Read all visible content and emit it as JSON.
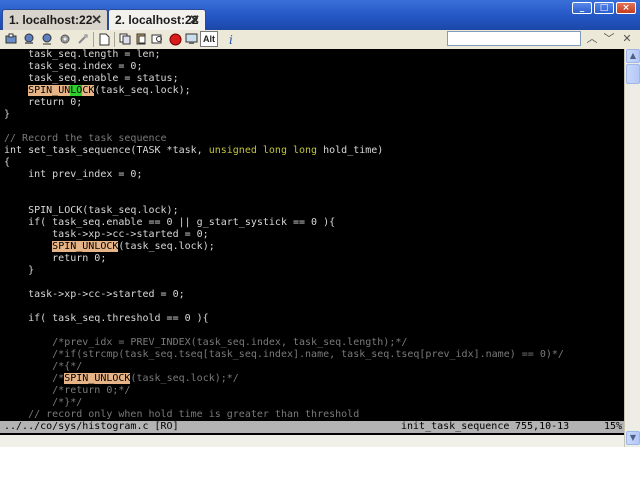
{
  "tabs": [
    {
      "label": "1. localhost:22"
    },
    {
      "label": "2. localhost:22"
    }
  ],
  "window_buttons": {
    "minimize": "_",
    "maximize": "□",
    "close": "×"
  },
  "toolbar": {
    "alt_label": "Alt",
    "search_value": "",
    "icons": [
      "connect-icon",
      "disconnect-icon",
      "new-session-icon",
      "settings-icon",
      "page-icon",
      "copy-icon",
      "paste-icon",
      "find-icon",
      "record-icon",
      "screen-icon",
      "alt-key-button",
      "info-icon"
    ]
  },
  "code_lines": [
    [
      {
        "t": "    task_seq.length = len;"
      }
    ],
    [
      {
        "t": "    task_seq.index = 0;"
      }
    ],
    [
      {
        "t": "    task_seq.enable = status;"
      }
    ],
    [
      {
        "t": "    "
      },
      {
        "t": "SPIN_UN",
        "k": "hl"
      },
      {
        "t": "L",
        "k": "cur"
      },
      {
        "t": "O",
        "k": "cur"
      },
      {
        "t": "CK",
        "k": "hl"
      },
      {
        "t": "(task_seq.lock);"
      }
    ],
    [
      {
        "t": "    return 0;"
      }
    ],
    [
      {
        "t": "}"
      }
    ],
    [
      {
        "t": ""
      }
    ],
    [
      {
        "t": "// Record the task sequence",
        "k": "c"
      }
    ],
    [
      {
        "t": "int set_task_sequence(TASK *task, "
      },
      {
        "t": "unsigned long long",
        "k": "typ"
      },
      {
        "t": " hold_time)"
      }
    ],
    [
      {
        "t": "{"
      }
    ],
    [
      {
        "t": "    int prev_index = 0;"
      }
    ],
    [
      {
        "t": ""
      }
    ],
    [
      {
        "t": ""
      }
    ],
    [
      {
        "t": "    SPIN_LOCK(task_seq.lock);"
      }
    ],
    [
      {
        "t": "    if( task_seq.enable == 0 || g_start_systick == 0 ){"
      }
    ],
    [
      {
        "t": "        task->xp->cc->started = 0;"
      }
    ],
    [
      {
        "t": "        "
      },
      {
        "t": "SPIN_UNLOCK",
        "k": "hl"
      },
      {
        "t": "(task_seq.lock);"
      }
    ],
    [
      {
        "t": "        return 0;"
      }
    ],
    [
      {
        "t": "    }"
      }
    ],
    [
      {
        "t": ""
      }
    ],
    [
      {
        "t": "    task->xp->cc->started = 0;"
      }
    ],
    [
      {
        "t": ""
      }
    ],
    [
      {
        "t": "    if( task_seq.threshold == 0 ){"
      }
    ],
    [
      {
        "t": ""
      }
    ],
    [
      {
        "t": "        /*prev_idx = PREV_INDEX(task_seq.index, task_seq.length);*/",
        "k": "c"
      }
    ],
    [
      {
        "t": "        /*if(strcmp(task_seq.tseq[task_seq.index].name, task_seq.tseq[prev_idx].name) == 0)*/",
        "k": "c"
      }
    ],
    [
      {
        "t": "        /*{*/",
        "k": "c"
      }
    ],
    [
      {
        "t": "        /*",
        "k": "c"
      },
      {
        "t": "SPIN_UNLOCK",
        "k": "hl"
      },
      {
        "t": "(task_seq.lock);*/",
        "k": "c"
      }
    ],
    [
      {
        "t": "        /*return 0;*/",
        "k": "c"
      }
    ],
    [
      {
        "t": "        /*}*/",
        "k": "c"
      }
    ],
    [
      {
        "t": "    // record only when hold time is greater than threshold",
        "k": "c"
      }
    ]
  ],
  "status": {
    "file": "../../co/sys/histogram.c [RO]",
    "function": "init_task_sequence",
    "position": "755,10-13",
    "percent": "15%"
  }
}
